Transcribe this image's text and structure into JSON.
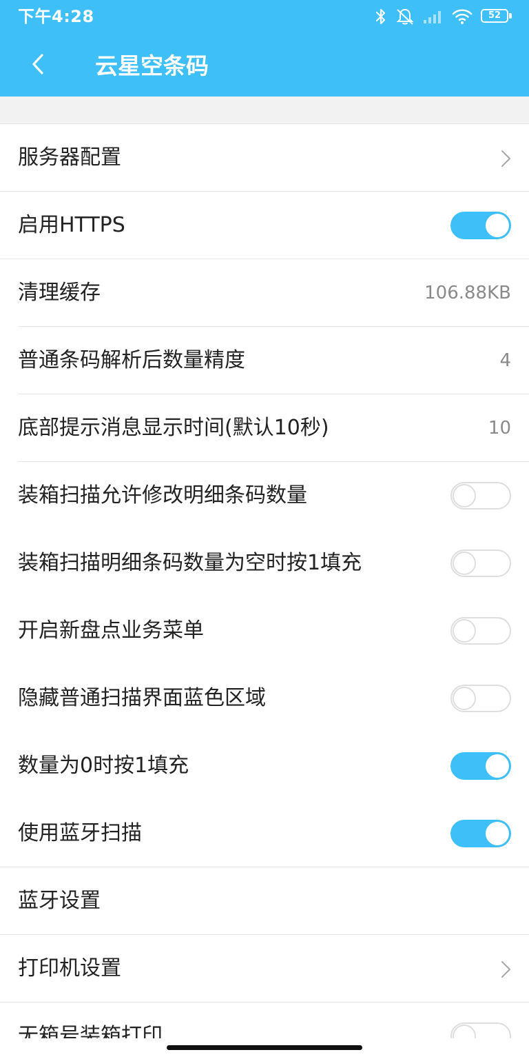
{
  "colors": {
    "accent": "#3ebff8",
    "background": "#ffffff",
    "band": "#f2f2f2",
    "divider": "#e6e6e6",
    "label": "#222222",
    "value": "#8a8a8a",
    "toggle_off_border": "#dedede"
  },
  "status_bar": {
    "time": "下午4:28",
    "icons": [
      "bluetooth-icon",
      "bell-muted-icon",
      "signal-icon",
      "wifi-icon",
      "battery-icon"
    ],
    "battery_level": "52"
  },
  "header": {
    "back_icon": "chevron-left-icon",
    "title": "云星空条码"
  },
  "settings": [
    {
      "label": "服务器配置",
      "control": "chevron",
      "divider": "full"
    },
    {
      "label": "启用HTTPS",
      "control": "toggle",
      "on": true,
      "divider": "full"
    },
    {
      "label": "清理缓存",
      "control": "value",
      "value": "106.88KB",
      "divider": "inset"
    },
    {
      "label": "普通条码解析后数量精度",
      "control": "value",
      "value": "4",
      "divider": "inset"
    },
    {
      "label": "底部提示消息显示时间(默认10秒)",
      "control": "value",
      "value": "10",
      "divider": "inset"
    },
    {
      "label": "装箱扫描允许修改明细条码数量",
      "control": "toggle",
      "on": false,
      "divider": "none"
    },
    {
      "label": "装箱扫描明细条码数量为空时按1填充",
      "control": "toggle",
      "on": false,
      "divider": "none"
    },
    {
      "label": "开启新盘点业务菜单",
      "control": "toggle",
      "on": false,
      "divider": "none"
    },
    {
      "label": "隐藏普通扫描界面蓝色区域",
      "control": "toggle",
      "on": false,
      "divider": "none"
    },
    {
      "label": "数量为0时按1填充",
      "control": "toggle",
      "on": true,
      "divider": "none"
    },
    {
      "label": "使用蓝牙扫描",
      "control": "toggle",
      "on": true,
      "divider": "full"
    },
    {
      "label": "蓝牙设置",
      "control": "none",
      "divider": "full"
    },
    {
      "label": "打印机设置",
      "control": "chevron",
      "divider": "full"
    },
    {
      "label": "无箱号装箱打印",
      "control": "toggle",
      "on": false,
      "divider": "none"
    }
  ]
}
